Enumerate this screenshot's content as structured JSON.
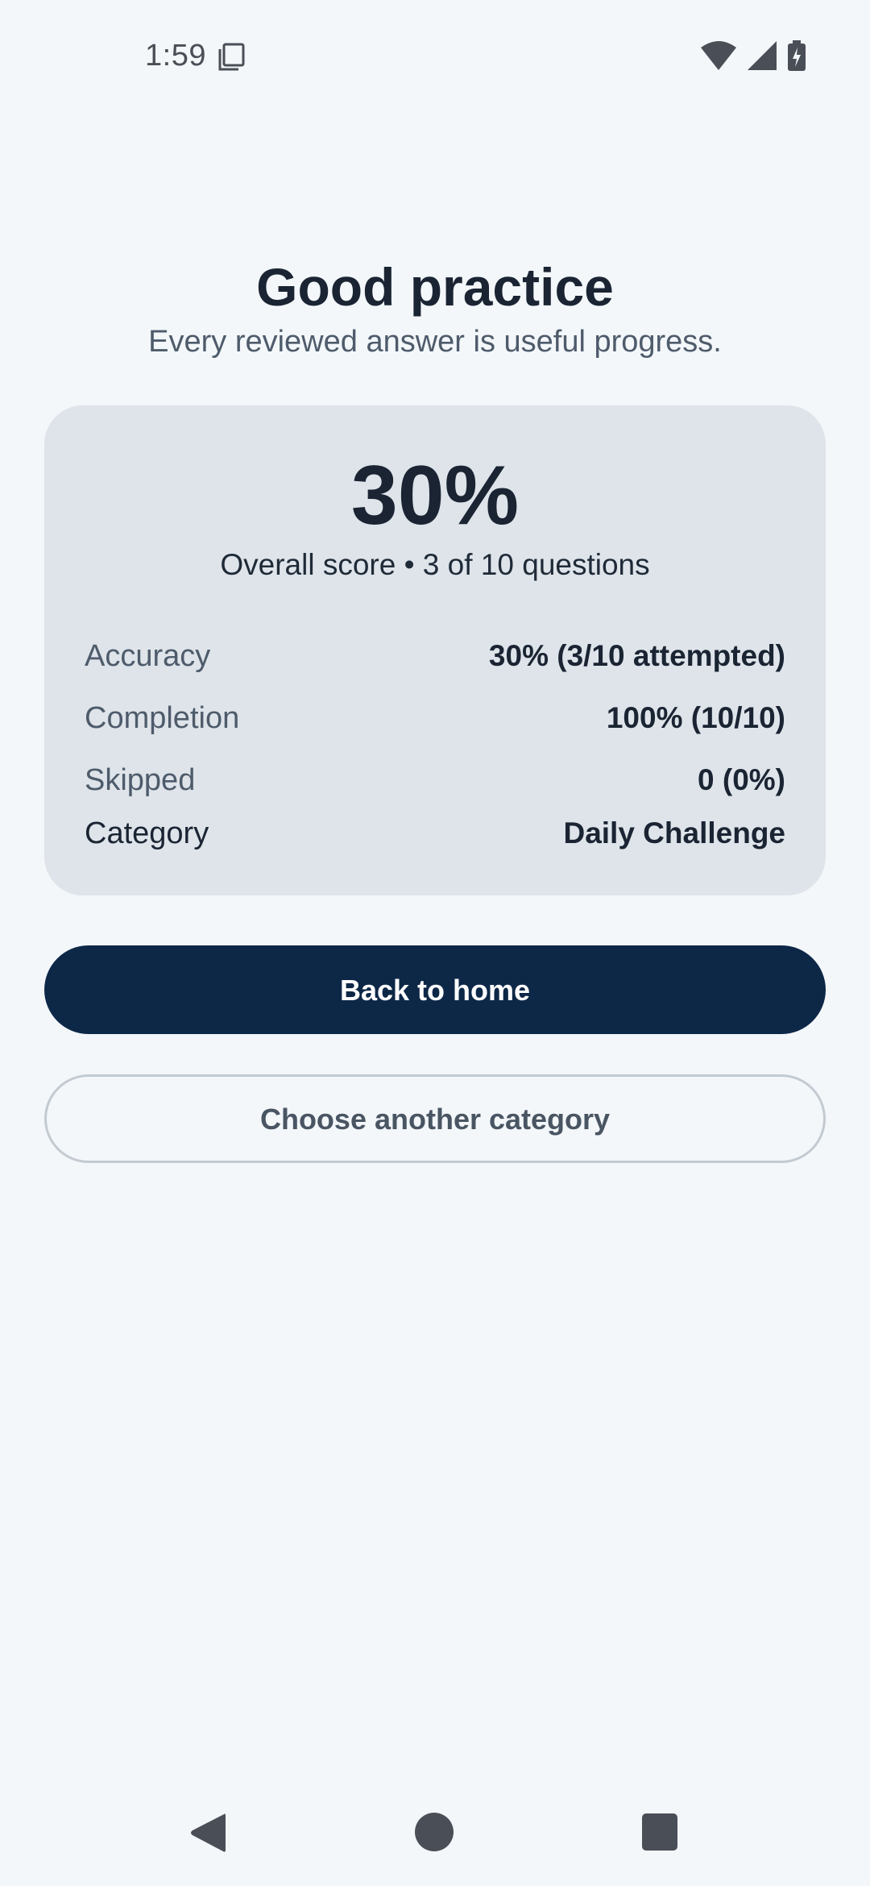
{
  "status_bar": {
    "time": "1:59",
    "icons": [
      "sim-card-icon",
      "wifi-icon",
      "cellular-signal-icon",
      "battery-charging-icon"
    ]
  },
  "results": {
    "title": "Good practice",
    "subtitle": "Every reviewed answer is useful progress.",
    "score": "30%",
    "score_caption": "Overall score • 3 of 10 questions",
    "stats": [
      {
        "label": "Accuracy",
        "value": "30% (3/10 attempted)"
      },
      {
        "label": "Completion",
        "value": "100% (10/10)"
      },
      {
        "label": "Skipped",
        "value": "0 (0%)"
      },
      {
        "label": "Category",
        "value": "Daily Challenge"
      }
    ]
  },
  "actions": {
    "primary_label": "Back to home",
    "secondary_label": "Choose another category"
  },
  "nav_bar": {
    "icons": [
      "back-icon",
      "home-icon",
      "recents-icon"
    ]
  },
  "colors": {
    "background": "#f3f7fa",
    "card": "#dee4e9",
    "primary_button": "#0d2747",
    "text_dark": "#1a2433",
    "text_muted": "#4e5b6b"
  }
}
